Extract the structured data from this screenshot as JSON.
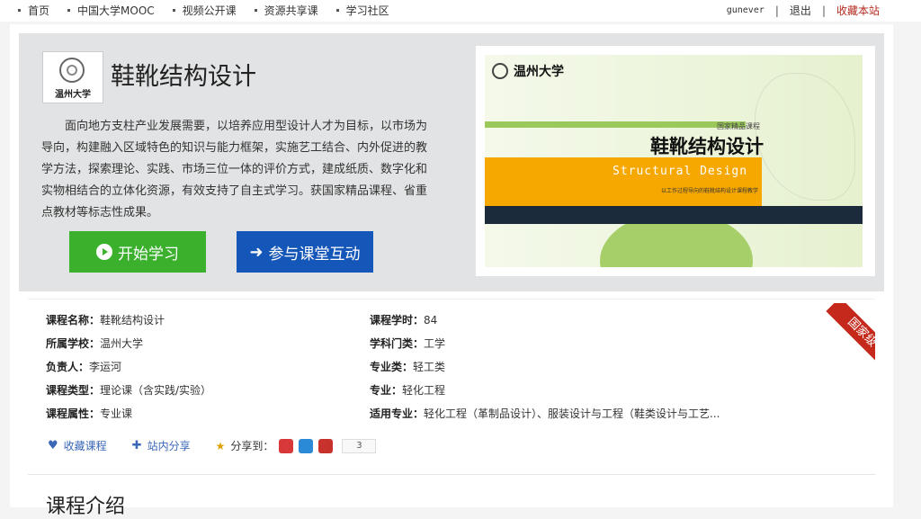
{
  "topnav": {
    "items": [
      "首页",
      "中国大学MOOC",
      "视频公开课",
      "资源共享课",
      "学习社区"
    ],
    "username": "gunever",
    "logout": "退出",
    "favorite_site": "收藏本站"
  },
  "hero": {
    "logo_text": "温州大学",
    "title": "鞋靴结构设计",
    "description": "面向地方支柱产业发展需要，以培养应用型设计人才为目标，以市场为导向，构建融入区域特色的知识与能力框架，实施艺工结合、内外促进的教学方法，探索理论、实践、市场三位一体的评价方式，建成纸质、数字化和实物相结合的立体化资源，有效支持了自主式学习。获国家精品课程、省重点教材等标志性成果。",
    "start_button": "开始学习",
    "interact_button": "参与课堂互动"
  },
  "cover": {
    "university": "温州大学",
    "small_label": "国家精品课程",
    "title": "鞋靴结构设计",
    "english_title": "Structural Design",
    "subtitle": "以工作过程导向的鞋靴结构设计课程教学"
  },
  "info": {
    "badge": "国家级",
    "fields": [
      {
        "label": "课程名称：",
        "value": "鞋靴结构设计"
      },
      {
        "label": "所属学校：",
        "value": "温州大学"
      },
      {
        "label": "负责人：",
        "value": "李运河"
      },
      {
        "label": "课程类型：",
        "value": "理论课（含实践/实验）"
      },
      {
        "label": "课程属性：",
        "value": "专业课"
      },
      {
        "label": "课程学时：",
        "value": "84"
      },
      {
        "label": "学科门类：",
        "value": "工学"
      },
      {
        "label": "专业类：",
        "value": "轻工类"
      },
      {
        "label": "专业：",
        "value": "轻化工程"
      },
      {
        "label": "适用专业：",
        "value": "轻化工程（革制品设计）、服装设计与工程（鞋类设计与工艺..."
      }
    ],
    "collect": "收藏课程",
    "site_share": "站内分享",
    "share_to": "分享到：",
    "share_count": "3"
  },
  "section": {
    "title": "课程介绍"
  },
  "colors": {
    "start_green": "#3ab02d",
    "interact_blue": "#1557b8",
    "badge_red": "#c4291c",
    "link_blue": "#3a67b7"
  }
}
